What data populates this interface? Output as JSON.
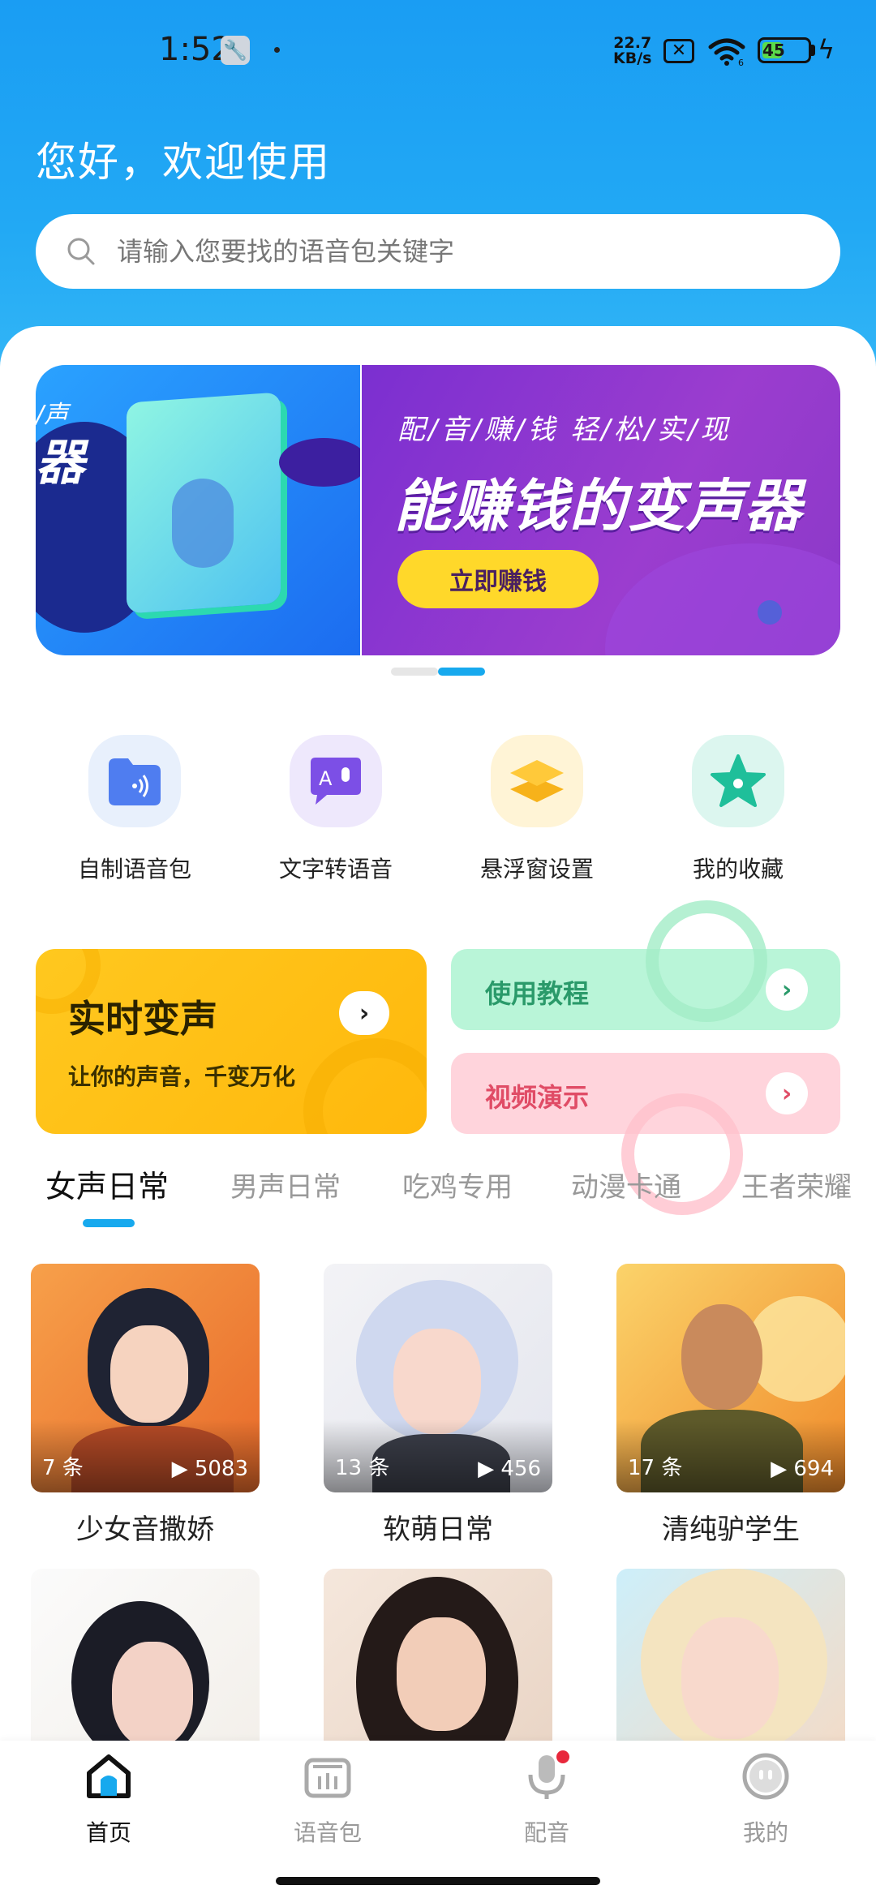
{
  "status_bar": {
    "time": "1:52",
    "net_speed_value": "22.7",
    "net_speed_unit": "KB/s",
    "battery": "45",
    "wifi_badge": "6"
  },
  "header": {
    "greeting": "您好，欢迎使用",
    "search_placeholder": "请输入您要找的语音包关键字"
  },
  "banner": {
    "left_partial_text": "/声",
    "left_partial_big": "器",
    "subtitle": "配/音/赚/钱      轻/松/实/现",
    "title": "能赚钱的变声器",
    "button": "立即赚钱",
    "active_page_index": 1,
    "page_count": 2
  },
  "features": [
    {
      "label": "自制语音包",
      "icon": "folder-audio-icon"
    },
    {
      "label": "文字转语音",
      "icon": "text-to-speech-icon"
    },
    {
      "label": "悬浮窗设置",
      "icon": "layers-icon"
    },
    {
      "label": "我的收藏",
      "icon": "star-icon"
    }
  ],
  "promos": {
    "realtime": {
      "title": "实时变声",
      "subtitle": "让你的声音，千变万化",
      "arrow": "›"
    },
    "tutorial": {
      "title": "使用教程",
      "arrow": "›"
    },
    "video": {
      "title": "视频演示",
      "arrow": "›"
    }
  },
  "tabs": [
    "女声日常",
    "男声日常",
    "吃鸡专用",
    "动漫卡通",
    "王者荣耀"
  ],
  "active_tab": 0,
  "voice_packs": [
    {
      "name": "少女音撒娇",
      "count": "7 条",
      "plays": "5083"
    },
    {
      "name": "软萌日常",
      "count": "13 条",
      "plays": "456"
    },
    {
      "name": "清纯驴学生",
      "count": "17 条",
      "plays": "694"
    },
    {
      "name": "",
      "count": "",
      "plays": ""
    },
    {
      "name": "",
      "count": "",
      "plays": ""
    },
    {
      "name": "",
      "count": "",
      "plays": ""
    }
  ],
  "bottom_nav": [
    {
      "label": "首页",
      "icon": "home-icon",
      "active": true
    },
    {
      "label": "语音包",
      "icon": "voice-pack-icon",
      "active": false
    },
    {
      "label": "配音",
      "icon": "microphone-icon",
      "active": false,
      "badge": true
    },
    {
      "label": "我的",
      "icon": "profile-icon",
      "active": false
    }
  ],
  "colors": {
    "accent": "#17a9ee",
    "header_blue": "#1a9df3",
    "promo_yellow": "#ffc81f",
    "promo_green": "#b9f5d8",
    "promo_pink": "#ffd4dc",
    "banner_purple": "#8a38c8",
    "badge_red": "#e8283c"
  }
}
